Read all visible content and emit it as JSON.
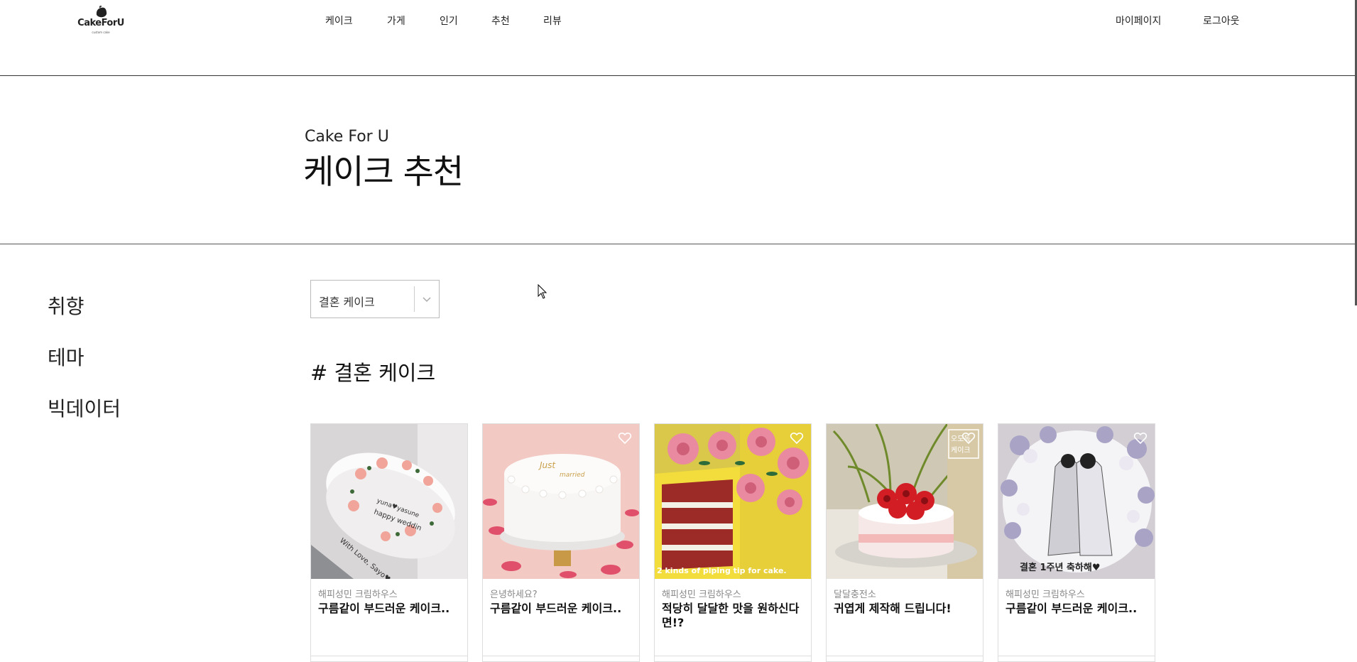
{
  "header": {
    "logo": {
      "text": "CakeForU",
      "subtext": "custom cake",
      "icon": "cake-icon"
    },
    "nav": [
      "케이크",
      "가게",
      "인기",
      "추천",
      "리뷰"
    ],
    "right": [
      "마이페이지",
      "로그아웃"
    ]
  },
  "hero": {
    "subtitle": "Cake For U",
    "title": "케이크 추천"
  },
  "sidebar": [
    "취향",
    "테마",
    "빅데이터"
  ],
  "filter": {
    "selected": "결혼 케이크",
    "icon": "chevron-down-icon"
  },
  "section_title": "# 결혼 케이크",
  "cards": [
    {
      "shop": "해피성민 크림하우스",
      "name": "구름같이 부드러운 케이크..",
      "liked": false,
      "heart_icon": "heart-icon"
    },
    {
      "shop": "은녕하세요?",
      "name": "구름같이 부드러운 케이크..",
      "liked": false,
      "heart_icon": "heart-icon"
    },
    {
      "shop": "해피성민 크림하우스",
      "name": "적당히 달달한 맛을 원하신다면!?",
      "liked": false,
      "heart_icon": "heart-icon"
    },
    {
      "shop": "달달충전소",
      "name": "귀엽게 제작해 드립니다!",
      "liked": false,
      "heart_icon": "heart-icon"
    },
    {
      "shop": "해피성민 크림하우스",
      "name": "구름같이 부드러운 케이크..",
      "liked": false,
      "heart_icon": "heart-icon"
    }
  ],
  "image_text": {
    "card1_line1": "yuna♥yasune",
    "card1_line2": "happy weddin",
    "card1_line3": "With Love, Sayo♥Seiji",
    "card2_line1": "Just",
    "card2_line2": "married",
    "card3_caption": "2 kinds of piping tip for cake.",
    "card4_badge1": "오도독",
    "card4_badge2": "케이크",
    "card5_caption": "결혼 1주년 축하해♥"
  }
}
